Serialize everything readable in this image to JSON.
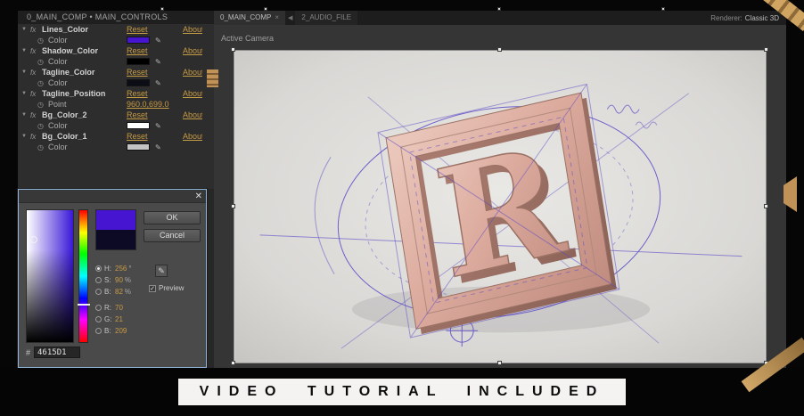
{
  "icons": {
    "twirl": "▼",
    "fx": "fx",
    "stopwatch": "◷",
    "eyedropper": "✎",
    "close": "✕",
    "check": "✓",
    "tab_arrow": "◀",
    "tab_close": "×"
  },
  "effect_controls": {
    "header": "0_MAIN_COMP • MAIN_CONTROLS",
    "reset_label": "Reset",
    "about_label": "About",
    "effects": [
      {
        "name": "Lines_Color",
        "param": "Color",
        "swatch": "#4615D1"
      },
      {
        "name": "Shadow_Color",
        "param": "Color",
        "swatch": "#000000"
      },
      {
        "name": "Tagline_Color",
        "param": "Color",
        "swatch": "#0d0d15"
      },
      {
        "name": "Tagline_Position",
        "param": "Point",
        "value": "960.0,699.0"
      },
      {
        "name": "Bg_Color_2",
        "param": "Color",
        "swatch": "#ffffff"
      },
      {
        "name": "Bg_Color_1",
        "param": "Color",
        "swatch": "#c3c3c3"
      }
    ]
  },
  "color_picker": {
    "ok": "OK",
    "cancel": "Cancel",
    "preview": "Preview",
    "hex_prefix": "#",
    "hex": "4615D1",
    "new_color": "#4615D1",
    "old_color": "#0c0a24",
    "fields": [
      {
        "label": "H:",
        "value": "256",
        "unit": "°"
      },
      {
        "label": "S:",
        "value": "90",
        "unit": "%"
      },
      {
        "label": "B:",
        "value": "82",
        "unit": "%"
      },
      {
        "label": "R:",
        "value": "70",
        "unit": ""
      },
      {
        "label": "G:",
        "value": "21",
        "unit": ""
      },
      {
        "label": "B:",
        "value": "209",
        "unit": ""
      }
    ]
  },
  "viewer": {
    "tab1": "0_MAIN_COMP",
    "tab2": "2_AUDIO_FILE",
    "renderer_label": "Renderer:",
    "renderer_value": "Classic 3D",
    "camera": "Active Camera"
  },
  "banner": {
    "text": "VIDEO TUTORIAL INCLUDED"
  }
}
